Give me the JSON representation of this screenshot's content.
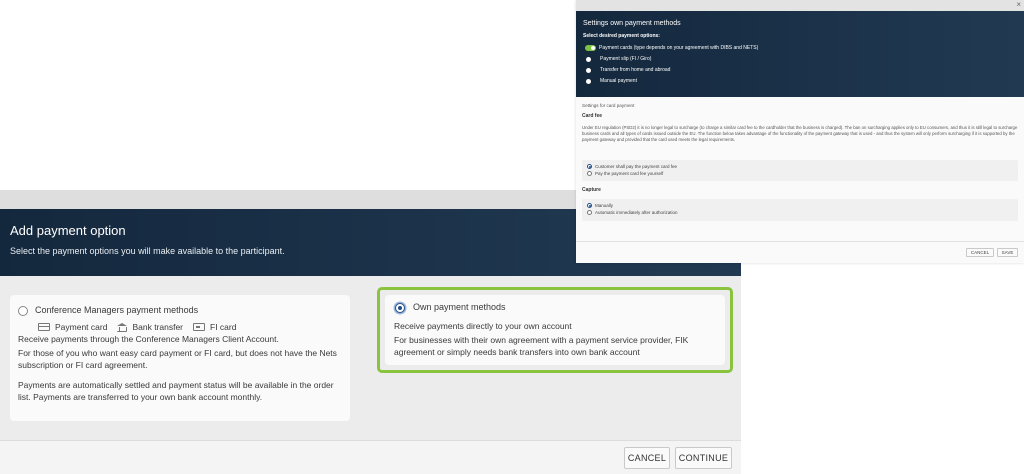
{
  "add_dialog": {
    "title": "Add payment option",
    "subtitle": "Select the payment options you will make available to the participant.",
    "cm_card": {
      "title": "Conference Managers payment methods",
      "methods": [
        {
          "label": "Payment card",
          "icon": "credit-card-icon"
        },
        {
          "label": "Bank transfer",
          "icon": "bank-icon"
        },
        {
          "label": "FI card",
          "icon": "fi-card-icon"
        }
      ],
      "lead": "Receive payments through the Conference Managers Client Account.",
      "desc1": "For those of you who want easy card payment or FI card, but does not have the Nets subscription or FI card agreement.",
      "desc2": "Payments are automatically settled and payment status will be available in the order list. Payments are transferred to your own bank account monthly."
    },
    "own_card": {
      "title": "Own payment methods",
      "lead": "Receive payments directly to your own account",
      "desc": "For businesses with their own agreement with a payment service provider, FIK agreement or simply needs bank transfers into own bank account",
      "highlight_color": "#8ac43f"
    },
    "buttons": {
      "cancel": "CANCEL",
      "continue": "CONTINUE"
    }
  },
  "settings_dialog": {
    "close": "×",
    "title": "Settings own payment methods",
    "subtitle": "Select desired payment options:",
    "options": [
      "Payment cards (type depends on your agreement with DIBS and NETS)",
      "Payment slip (FI / Giro)",
      "Transfer from home and abroad",
      "Manual payment"
    ],
    "card_settings_label": "Settings for card payment",
    "card_fee_heading": "Card fee",
    "card_fee_text": "Under EU regulation (PSD2) it is no longer legal to surcharge (to charge a similar card fee to the cardholder that the business is charged). The ban on surcharging applies only to EU consumers, and thus it is still legal to surcharge business cards and all types of cards issued outside the EU. The function below takes advantage of the functionality of the payment gateway that is used - and thus the system will only perform surcharging if it is supported by the payment gateway and provided that the card used meets the legal requirements.",
    "fee_options": [
      "Customer shall pay the payment card fee",
      "Pay the payment card fee yourself"
    ],
    "capture_heading": "Capture",
    "capture_options": [
      "Manually",
      "Automatic immediately after authorization"
    ],
    "buttons": {
      "cancel": "CANCEL",
      "save": "SAVE"
    },
    "toggle_color": "#7fc243"
  }
}
